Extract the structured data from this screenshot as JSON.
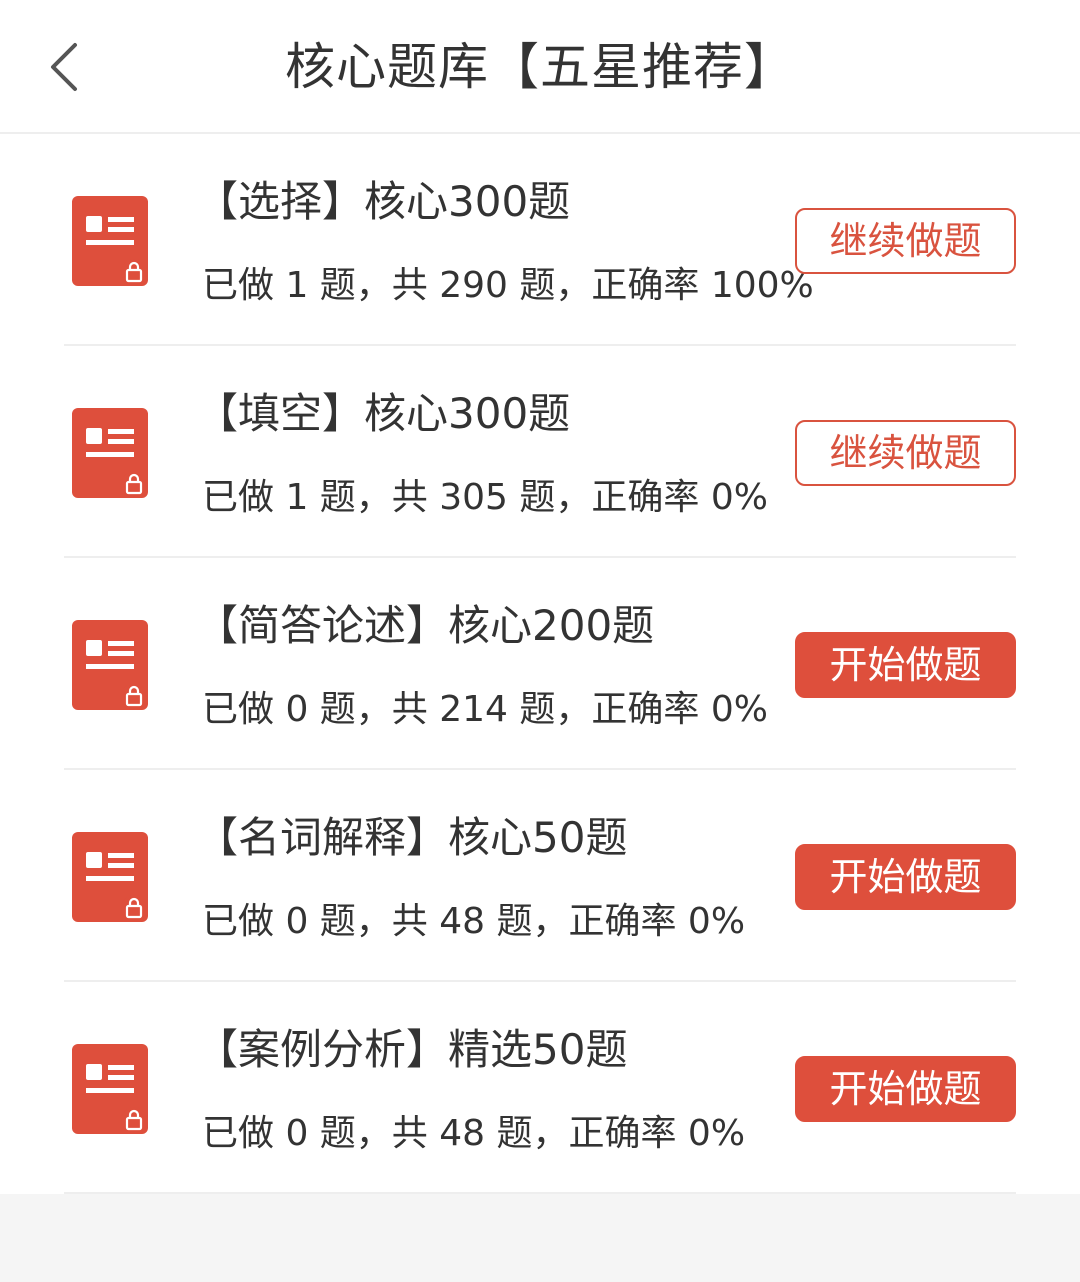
{
  "header": {
    "title": "核心题库【五星推荐】",
    "back_icon": "chevron-left-icon"
  },
  "colors": {
    "accent": "#de4f3c",
    "outline": "#d9533f",
    "text": "#333333",
    "background": "#f5f5f5"
  },
  "list": {
    "items": [
      {
        "title": "【选择】核心300题",
        "stats": "已做 1 题，共 290 题，正确率 100%",
        "button": "继续做题",
        "button_style": "continue",
        "icon": "locked-document-icon"
      },
      {
        "title": "【填空】核心300题",
        "stats": "已做 1 题，共 305 题，正确率 0%",
        "button": "继续做题",
        "button_style": "continue",
        "icon": "locked-document-icon"
      },
      {
        "title": "【简答论述】核心200题",
        "stats": "已做 0 题，共 214 题，正确率 0%",
        "button": "开始做题",
        "button_style": "start",
        "icon": "locked-document-icon"
      },
      {
        "title": "【名词解释】核心50题",
        "stats": "已做 0 题，共 48 题，正确率 0%",
        "button": "开始做题",
        "button_style": "start",
        "icon": "locked-document-icon"
      },
      {
        "title": "【案例分析】精选50题",
        "stats": "已做 0 题，共 48 题，正确率 0%",
        "button": "开始做题",
        "button_style": "start",
        "icon": "locked-document-icon"
      }
    ]
  }
}
